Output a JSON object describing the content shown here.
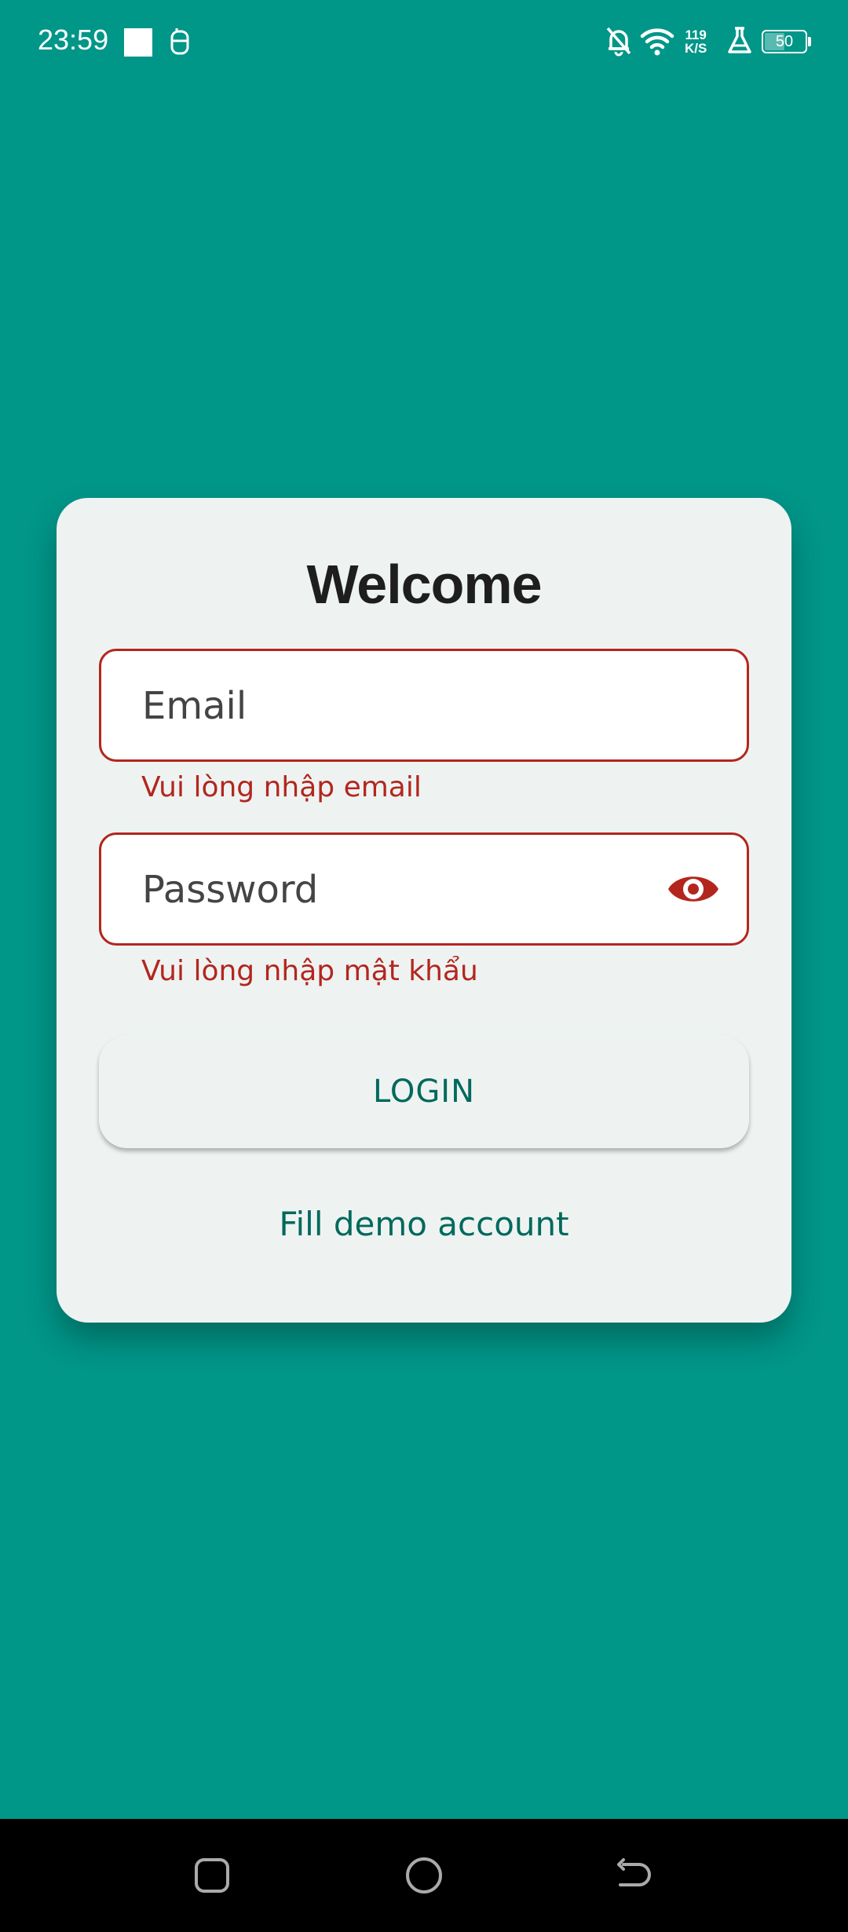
{
  "status_bar": {
    "time": "23:59",
    "net_speed_value": "119",
    "net_speed_unit": "K/S",
    "battery": "50",
    "battery_level": 0.5
  },
  "login": {
    "title": "Welcome",
    "email_placeholder": "Email",
    "email_error": "Vui lòng nhập email",
    "password_placeholder": "Password",
    "password_error": "Vui lòng nhập mật khẩu",
    "login_button": "LOGIN",
    "demo_link": "Fill demo account"
  },
  "colors": {
    "background": "#009688",
    "card": "#eef3f2",
    "error": "#b3261e",
    "accent": "#00695c"
  },
  "icons": {
    "password_toggle": "eye-icon",
    "nav_recent": "square-icon",
    "nav_home": "circle-icon",
    "nav_back": "back-arrow-icon"
  }
}
